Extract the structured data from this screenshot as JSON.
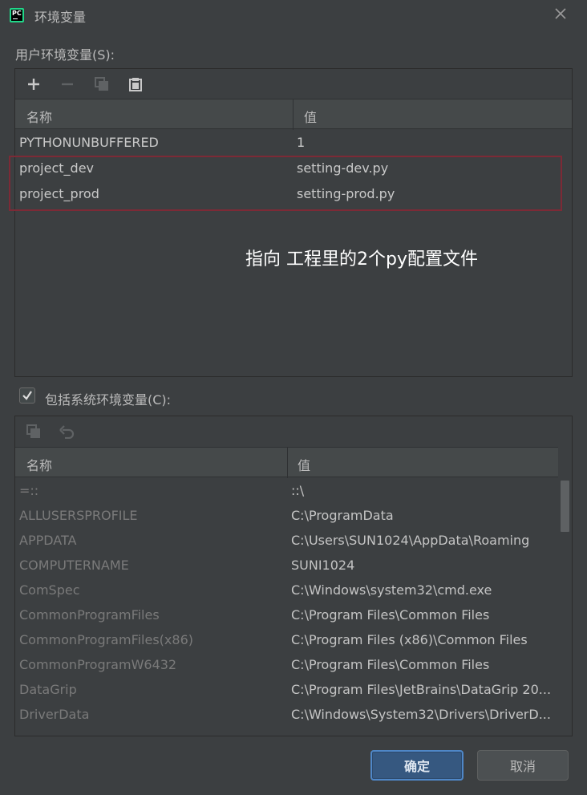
{
  "window": {
    "title": "环境变量"
  },
  "user_section": {
    "label": "用户环境变量(S):",
    "columns": {
      "name": "名称",
      "value": "值"
    },
    "rows": [
      {
        "name": "PYTHONUNBUFFERED",
        "value": "1"
      },
      {
        "name": "project_dev",
        "value": "setting-dev.py"
      },
      {
        "name": "project_prod",
        "value": "setting-prod.py"
      }
    ],
    "annotation": "指向 工程里的2个py配置文件"
  },
  "include_system": {
    "label": "包括系统环境变量(C):",
    "checked": true
  },
  "system_section": {
    "columns": {
      "name": "名称",
      "value": "值"
    },
    "rows": [
      {
        "name": "=::",
        "value": "::\\"
      },
      {
        "name": "ALLUSERSPROFILE",
        "value": "C:\\ProgramData"
      },
      {
        "name": "APPDATA",
        "value": "C:\\Users\\SUN1024\\AppData\\Roaming"
      },
      {
        "name": "COMPUTERNAME",
        "value": "SUNI1024"
      },
      {
        "name": "ComSpec",
        "value": "C:\\Windows\\system32\\cmd.exe"
      },
      {
        "name": "CommonProgramFiles",
        "value": "C:\\Program Files\\Common Files"
      },
      {
        "name": "CommonProgramFiles(x86)",
        "value": "C:\\Program Files (x86)\\Common Files"
      },
      {
        "name": "CommonProgramW6432",
        "value": "C:\\Program Files\\Common Files"
      },
      {
        "name": "DataGrip",
        "value": "C:\\Program Files\\JetBrains\\DataGrip 20..."
      },
      {
        "name": "DriverData",
        "value": "C:\\Windows\\System32\\Drivers\\DriverD..."
      }
    ]
  },
  "buttons": {
    "ok": "确定",
    "cancel": "取消"
  },
  "colors": {
    "background": "#3c3f41",
    "header": "#45494a",
    "accent": "#365880",
    "highlight": "#7d2a36"
  },
  "icons": {
    "add": "plus-icon",
    "remove": "minus-icon",
    "copy": "copy-icon",
    "paste": "paste-icon",
    "revert": "undo-icon",
    "close": "close-icon",
    "app": "pycharm-icon"
  }
}
